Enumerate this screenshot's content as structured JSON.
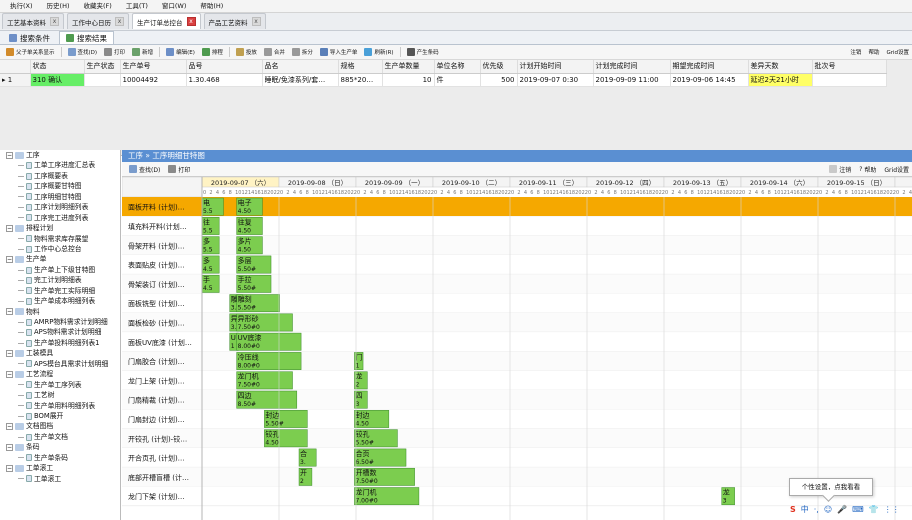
{
  "menu": [
    "执行(X)",
    "历史(H)",
    "收藏夹(F)",
    "工具(T)",
    "窗口(W)",
    "帮助(H)"
  ],
  "doc_tabs": [
    {
      "label": "工艺基本资料",
      "close": "x"
    },
    {
      "label": "工作中心日历",
      "close": "x"
    },
    {
      "label": "生产订单总控台",
      "close": "x"
    },
    {
      "label": "产品工艺资料",
      "close": "x"
    }
  ],
  "sub_tabs": [
    "搜索条件",
    "搜索结果"
  ],
  "toolbar": [
    "父子单关系显示",
    "查找(D)",
    "打印",
    "新增",
    "编辑(E)",
    "排程",
    "投放",
    "合并",
    "拆分",
    "导入生产单",
    "刷新(R)",
    "产生条码"
  ],
  "toolbar_right": [
    "注销",
    "帮助",
    "Grid设置"
  ],
  "table": {
    "headers": [
      "状态",
      "生产状态",
      "生产单号",
      "品号",
      "品名",
      "规格",
      "生产单数量",
      "单位名称",
      "优先级",
      "计划开始时间",
      "计划完成时间",
      "期望完成时间",
      "差异天数",
      "批次号"
    ],
    "row": {
      "index": "1",
      "status": "310 确认",
      "prod_status": "",
      "order_no": "10004492",
      "item_no": "1.30.468",
      "name": "睡眠/免漆系列/套…",
      "spec": "885*20…",
      "qty": "10",
      "unit": "件",
      "priority": "500",
      "plan_start": "2019-09-07 0:30",
      "plan_end": "2019-09-09 11:00",
      "expect_end": "2019-09-06 14:45",
      "diff": "延迟2天21小时",
      "batch": ""
    }
  },
  "tree": [
    {
      "l": 0,
      "t": "工序",
      "open": true
    },
    {
      "l": 1,
      "t": "工单工序进度汇总表"
    },
    {
      "l": 1,
      "t": "工序概要表"
    },
    {
      "l": 1,
      "t": "工序概要甘特图"
    },
    {
      "l": 1,
      "t": "工序明细甘特图"
    },
    {
      "l": 1,
      "t": "工序计划明细列表"
    },
    {
      "l": 1,
      "t": "工序完工进度列表"
    },
    {
      "l": 0,
      "t": "排程计划",
      "open": true
    },
    {
      "l": 1,
      "t": "物料需求库存展望"
    },
    {
      "l": 1,
      "t": "工作中心总控台"
    },
    {
      "l": 0,
      "t": "生产单",
      "open": true
    },
    {
      "l": 1,
      "t": "生产单上下级甘特图"
    },
    {
      "l": 1,
      "t": "完工计划明细表"
    },
    {
      "l": 1,
      "t": "生产单完工实际明细"
    },
    {
      "l": 1,
      "t": "生产单成本明细列表"
    },
    {
      "l": 0,
      "t": "物料",
      "open": true
    },
    {
      "l": 1,
      "t": "AMRP物料需求计划明细"
    },
    {
      "l": 1,
      "t": "APS物料需求计划明细"
    },
    {
      "l": 1,
      "t": "生产单投料明细列表1"
    },
    {
      "l": 0,
      "t": "工装模具",
      "open": true
    },
    {
      "l": 1,
      "t": "APS模台具需求计划明细"
    },
    {
      "l": 0,
      "t": "工艺流程",
      "open": true
    },
    {
      "l": 1,
      "t": "生产单工序列表"
    },
    {
      "l": 1,
      "t": "工艺树"
    },
    {
      "l": 1,
      "t": "生产单用料明细列表"
    },
    {
      "l": 1,
      "t": "BOM展开"
    },
    {
      "l": 0,
      "t": "文档图档",
      "open": true
    },
    {
      "l": 1,
      "t": "生产单文档"
    },
    {
      "l": 0,
      "t": "条码",
      "open": true
    },
    {
      "l": 1,
      "t": "生产单条码"
    },
    {
      "l": 0,
      "t": "工单滚工",
      "open": true
    },
    {
      "l": 1,
      "t": "工单滚工"
    }
  ],
  "gantt": {
    "header": "工序 » 工序明细甘特图",
    "toolbar": [
      "查找(D)",
      "打印"
    ],
    "toolbar_right": [
      "注销",
      "帮助",
      "Grid设置"
    ],
    "dates": [
      "2019-09-07 （六）",
      "2019-09-08 （日）",
      "2019-09-09 （一）",
      "2019-09-10 （二）",
      "2019-09-11 （三）",
      "2019-09-12 （四）",
      "2019-09-13 （五）",
      "2019-09-14 （六）",
      "2019-09-15 （日）",
      "20"
    ],
    "hour_ticks": [
      "0",
      "2",
      "4",
      "6",
      "8",
      "10",
      "12",
      "14",
      "16",
      "18",
      "20",
      "22"
    ],
    "rows": [
      {
        "label": "面板开料 (计划)…",
        "bars": [
          {
            "t": "电",
            "v": "5.5",
            "s": 0.0,
            "w": 0.05
          },
          {
            "t": "电子",
            "v": "4.50",
            "s": 0.05,
            "w": 0.06
          }
        ]
      },
      {
        "label": "填充料开料(计划…",
        "bars": [
          {
            "t": "往",
            "v": "5.5",
            "s": 0.0,
            "w": 0.04
          },
          {
            "t": "往复",
            "v": "4.50",
            "s": 0.05,
            "w": 0.06
          }
        ]
      },
      {
        "label": "骨架开料 (计划)…",
        "bars": [
          {
            "t": "多",
            "v": "5.5",
            "s": 0.0,
            "w": 0.04
          },
          {
            "t": "多片",
            "v": "4.50",
            "s": 0.05,
            "w": 0.06
          }
        ]
      },
      {
        "label": "表面贴皮 (计划)…",
        "bars": [
          {
            "t": "多",
            "v": "4.5",
            "s": 0.0,
            "w": 0.04
          },
          {
            "t": "多层",
            "v": "5.50#",
            "s": 0.05,
            "w": 0.08
          }
        ]
      },
      {
        "label": "骨架装订 (计划)…",
        "bars": [
          {
            "t": "手",
            "v": "4.5",
            "s": 0.0,
            "w": 0.04
          },
          {
            "t": "手拉",
            "v": "5.50#",
            "s": 0.05,
            "w": 0.08
          }
        ]
      },
      {
        "label": "面板铣型 (计划)…",
        "bars": [
          {
            "t": "雕",
            "v": "3.",
            "s": 0.04,
            "w": 0.03
          },
          {
            "t": "雕刻",
            "v": "5.50#",
            "s": 0.05,
            "w": 0.1
          }
        ]
      },
      {
        "label": "面板检砂 (计划)…",
        "bars": [
          {
            "t": "异",
            "v": "3.",
            "s": 0.04,
            "w": 0.03
          },
          {
            "t": "异形砂",
            "v": "7.50#0",
            "s": 0.05,
            "w": 0.13
          }
        ]
      },
      {
        "label": "面板UV底漆 (计划…",
        "bars": [
          {
            "t": "U",
            "v": "1",
            "s": 0.04,
            "w": 0.02
          },
          {
            "t": "UV底漆",
            "v": "8.00#0",
            "s": 0.05,
            "w": 0.15
          }
        ]
      },
      {
        "label": "门扇胶合 (计划)…",
        "bars": [
          {
            "t": "冷压线",
            "v": "8.00#0",
            "s": 0.05,
            "w": 0.15
          },
          {
            "t": "门",
            "v": "1",
            "s": 0.22,
            "w": 0.02
          }
        ]
      },
      {
        "label": "龙门上架 (计划)…",
        "bars": [
          {
            "t": "龙门机",
            "v": "7.50#0",
            "s": 0.05,
            "w": 0.13
          },
          {
            "t": "龙",
            "v": "2",
            "s": 0.22,
            "w": 0.03
          }
        ]
      },
      {
        "label": "门扇精裁 (计划)…",
        "bars": [
          {
            "t": "四边",
            "v": "8.50#",
            "s": 0.05,
            "w": 0.14
          },
          {
            "t": "四",
            "v": "3",
            "s": 0.22,
            "w": 0.03
          }
        ]
      },
      {
        "label": "门扇封边 (计划)…",
        "bars": [
          {
            "t": "封边",
            "v": "5.50#",
            "s": 0.09,
            "w": 0.1
          },
          {
            "t": "封边",
            "v": "4.50",
            "s": 0.22,
            "w": 0.08
          }
        ]
      },
      {
        "label": "开铰孔 (计划)-铰…",
        "bars": [
          {
            "t": "铰孔",
            "v": "4.50",
            "s": 0.09,
            "w": 0.1
          },
          {
            "t": "铰孔",
            "v": "5.50#",
            "s": 0.22,
            "w": 0.1
          }
        ]
      },
      {
        "label": "开合页孔 (计划)…",
        "bars": [
          {
            "t": "合",
            "v": "3.",
            "s": 0.14,
            "w": 0.04
          },
          {
            "t": "合页",
            "v": "6.50#",
            "s": 0.22,
            "w": 0.12
          }
        ]
      },
      {
        "label": "底部开槽盲槽 (计…",
        "bars": [
          {
            "t": "开",
            "v": "2",
            "s": 0.14,
            "w": 0.03
          },
          {
            "t": "开槽数",
            "v": "7.50#0",
            "s": 0.22,
            "w": 0.14
          }
        ]
      },
      {
        "label": "龙门下架 (计划)…",
        "bars": [
          {
            "t": "龙门机",
            "v": "7.00#0",
            "s": 0.22,
            "w": 0.15
          },
          {
            "t": "龙",
            "v": "3",
            "s": 0.75,
            "w": 0.03
          }
        ]
      }
    ]
  },
  "toast": "个性设置，点我看看",
  "tray": [
    "S",
    "中",
    "·,",
    "☺",
    "🎤",
    "⌨",
    "👕",
    "⋮⋮"
  ],
  "colors": {
    "bar": "#7ccd4f",
    "highlight_row": "#f5a800",
    "date_first": "#fff3c4",
    "diff_bg": "#ffff66",
    "green_cell": "#66ee66"
  }
}
